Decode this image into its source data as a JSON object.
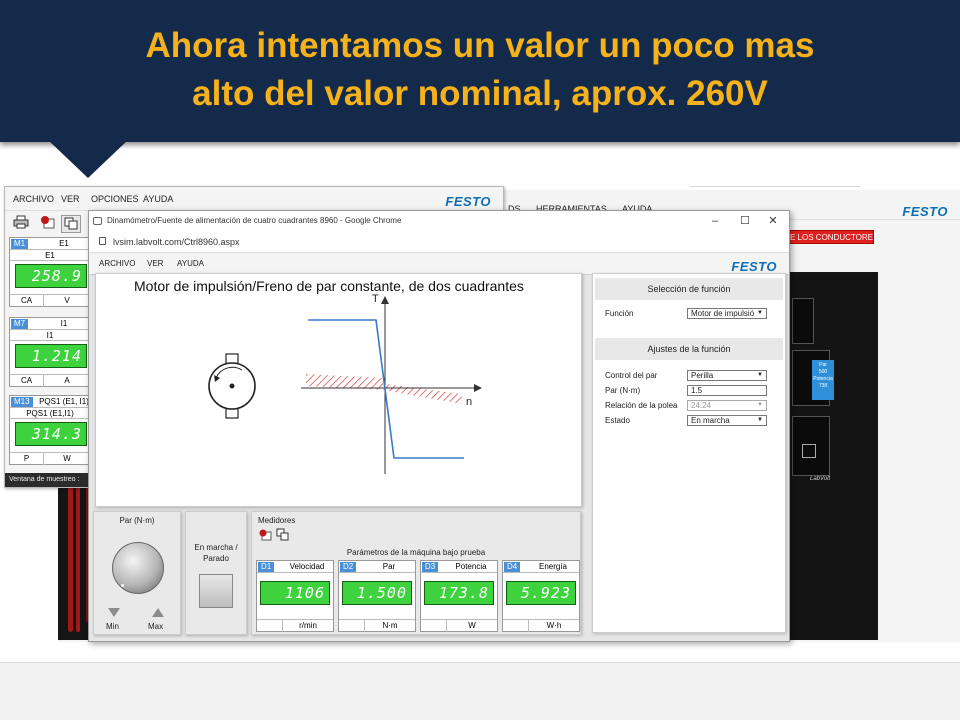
{
  "slide": {
    "title_line1": "Ahora intentamos un valor un poco mas",
    "title_line2": "alto del valor nominal, aprox. 260V",
    "title_color": "#f5b21b",
    "banner_color": "#142a4a"
  },
  "background_window": {
    "menu": [
      "DS",
      "HERRAMIENTAS",
      "AYUDA"
    ],
    "brand": "FESTO",
    "warning": "E LOS CONDUCTORES",
    "panel_display": [
      "Par",
      "500",
      "Potencia",
      "738"
    ],
    "logo": "LabVolt"
  },
  "meter_window": {
    "menu": [
      "ARCHIVO",
      "VER",
      "OPCIONES",
      "AYUDA"
    ],
    "brand": "FESTO",
    "toolbar_icons": [
      "printer-icon",
      "record-icon",
      "copy-icon"
    ],
    "meters": [
      {
        "tag": "M1",
        "name": "E1",
        "sub": "E1",
        "value": "258.9",
        "mode": "CA",
        "unit": "V"
      },
      {
        "tag": "M7",
        "name": "I1",
        "sub": "I1",
        "value": "1.214",
        "mode": "CA",
        "unit": "A"
      },
      {
        "tag": "M13",
        "name": "PQS1 (E1, I1)",
        "sub": "PQS1 (E1,I1)",
        "value": "314.3",
        "mode": "P",
        "unit": "W"
      }
    ],
    "status": "Ventana de muestreo :"
  },
  "chrome": {
    "title": "Dinamómetro/Fuente de alimentación de cuatro cuadrantes 8960 - Google Chrome",
    "url": "lvsim.labvolt.com/Ctrl8960.aspx",
    "menu": [
      "ARCHIVO",
      "VER",
      "AYUDA"
    ],
    "brand": "FESTO",
    "window_buttons": [
      "–",
      "☐",
      "✕"
    ]
  },
  "diagram": {
    "title": "Motor de impulsión/Freno de par constante, de dos cuadrantes",
    "axis_t": "T",
    "axis_n": "n"
  },
  "settings": {
    "section1": "Selección de función",
    "funcion_label": "Función",
    "funcion_value": "Motor de impulsió",
    "section2": "Ajustes de la función",
    "rows": [
      {
        "label": "Control del par",
        "value": "Perilla",
        "dropdown": true,
        "disabled": false
      },
      {
        "label": "Par (N·m)",
        "value": "1.5",
        "dropdown": false,
        "disabled": false
      },
      {
        "label": "Relación de la polea",
        "value": "24:24",
        "dropdown": true,
        "disabled": true
      },
      {
        "label": "Estado",
        "value": "En marcha",
        "dropdown": true,
        "disabled": false
      }
    ]
  },
  "controls": {
    "knob_title": "Par (N·m)",
    "min": "Min",
    "max": "Max",
    "run_title_1": "En marcha /",
    "run_title_2": "Parado",
    "meters_title": "Medidores",
    "meters_subtitle": "Parámetros de la máquina bajo prueba",
    "meters": [
      {
        "tag": "D1",
        "name": "Velocidad",
        "value": "1106",
        "unit": "r/min"
      },
      {
        "tag": "D2",
        "name": "Par",
        "value": "1.500",
        "unit": "N·m"
      },
      {
        "tag": "D3",
        "name": "Potencia",
        "value": "173.8",
        "unit": "W"
      },
      {
        "tag": "D4",
        "name": "Energía",
        "value": "5.923",
        "unit": "W·h"
      }
    ]
  }
}
